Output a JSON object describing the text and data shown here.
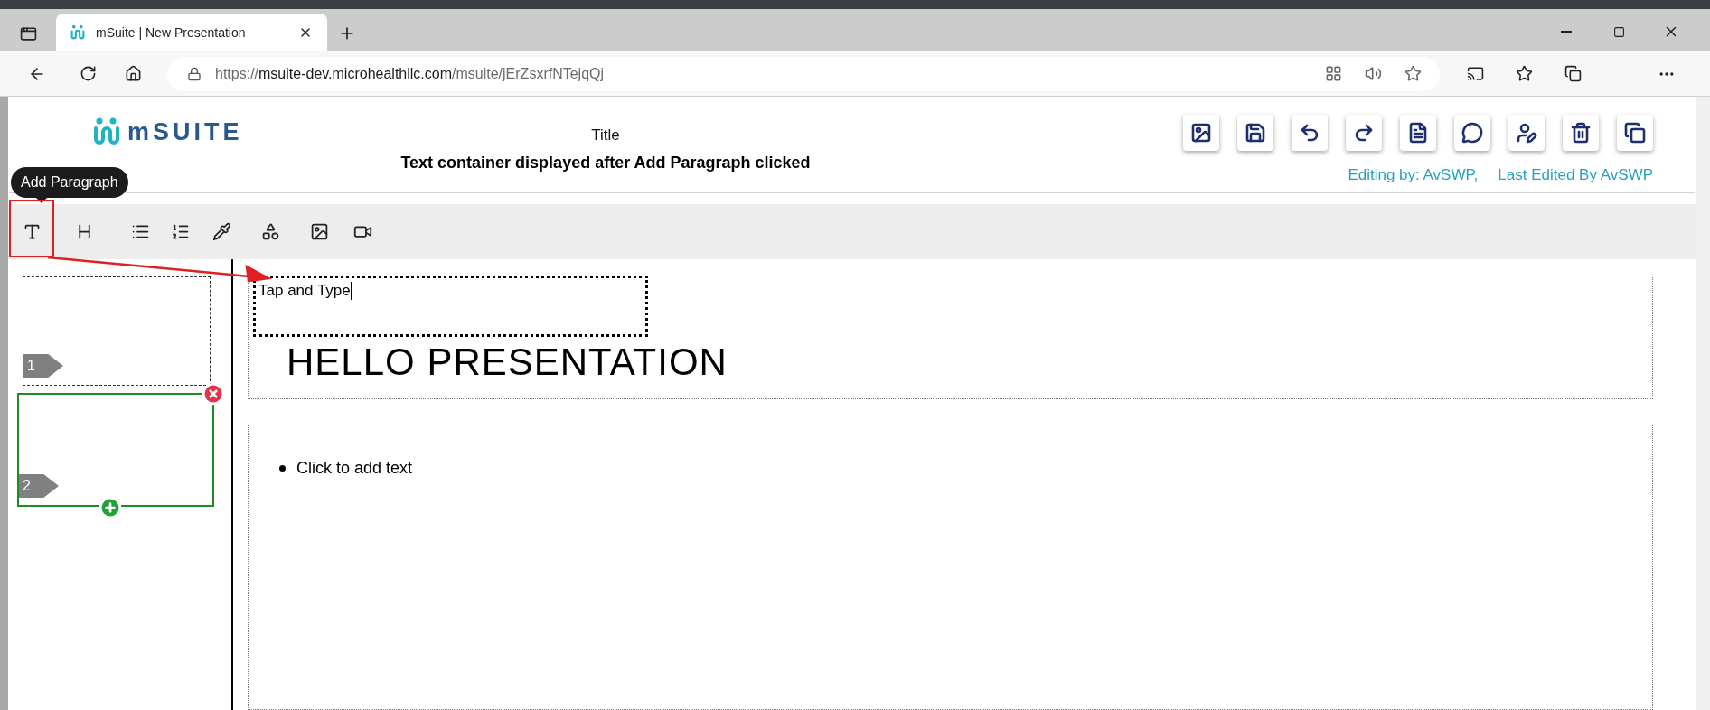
{
  "browser": {
    "tab_title": "mSuite | New Presentation",
    "url": {
      "scheme": "https://",
      "host": "msuite-dev.microhealthllc.com",
      "path": "/msuite/jErZsxrfNTejqQj"
    }
  },
  "header": {
    "logo_text": "mSUITE",
    "title": "Title",
    "subtitle": "Text container displayed after Add Paragraph clicked",
    "editing_by": "Editing by: AvSWP,",
    "last_edited": "Last Edited By AvSWP"
  },
  "toolbar": {
    "tooltip": "Add Paragraph"
  },
  "thumbnails": [
    {
      "number": "1",
      "selected": false
    },
    {
      "number": "2",
      "selected": true
    }
  ],
  "slides": [
    {
      "kind": "title",
      "heading": "HELLO PRESENTATION"
    },
    {
      "kind": "bullets",
      "bullets": [
        "Click to add text"
      ]
    }
  ],
  "text_container": {
    "value": "Tap and Type"
  }
}
